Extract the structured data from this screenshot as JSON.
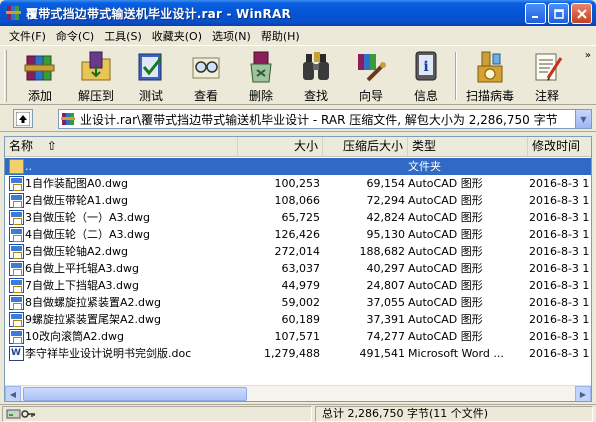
{
  "window": {
    "title": "覆带式挡边带式输送机毕业设计.rar - WinRAR"
  },
  "menu": [
    "文件(F)",
    "命令(C)",
    "工具(S)",
    "收藏夹(O)",
    "选项(N)",
    "帮助(H)"
  ],
  "toolbar": [
    {
      "label": "添加",
      "icon": "rar-books-icon"
    },
    {
      "label": "解压到",
      "icon": "extract-folder-icon"
    },
    {
      "label": "测试",
      "icon": "test-checkmark-icon"
    },
    {
      "label": "查看",
      "icon": "view-glasses-icon"
    },
    {
      "label": "删除",
      "icon": "delete-recycle-icon"
    },
    {
      "label": "查找",
      "icon": "find-binoculars-icon"
    },
    {
      "label": "向导",
      "icon": "wizard-icon"
    },
    {
      "label": "信息",
      "icon": "info-icon"
    },
    {
      "label": "扫描病毒",
      "icon": "virus-scan-icon"
    },
    {
      "label": "注释",
      "icon": "comment-icon"
    }
  ],
  "address": {
    "text": "业设计.rar\\覆带式挡边带式输送机毕业设计 - RAR 压缩文件, 解包大小为 2,286,750 字节"
  },
  "columns": [
    "名称",
    "大小",
    "压缩后大小",
    "类型",
    "修改时间"
  ],
  "files": [
    {
      "name": "..",
      "size": "",
      "packed": "",
      "type": "文件夹",
      "modified": "",
      "icon": "folder-icon",
      "selected": true
    },
    {
      "name": "1自作装配图A0.dwg",
      "size": "100,253",
      "packed": "69,154",
      "type": "AutoCAD 图形",
      "modified": "2016-8-3 1",
      "icon": "dwg-file-icon"
    },
    {
      "name": "2自做压带轮A1.dwg",
      "size": "108,066",
      "packed": "72,294",
      "type": "AutoCAD 图形",
      "modified": "2016-8-3 1",
      "icon": "dwg-file-icon"
    },
    {
      "name": "3自做压轮（一）A3.dwg",
      "size": "65,725",
      "packed": "42,824",
      "type": "AutoCAD 图形",
      "modified": "2016-8-3 1",
      "icon": "dwg-file-icon"
    },
    {
      "name": "4自做压轮（二）A3.dwg",
      "size": "126,426",
      "packed": "95,130",
      "type": "AutoCAD 图形",
      "modified": "2016-8-3 1",
      "icon": "dwg-file-icon"
    },
    {
      "name": "5自做压轮轴A2.dwg",
      "size": "272,014",
      "packed": "188,682",
      "type": "AutoCAD 图形",
      "modified": "2016-8-3 1",
      "icon": "dwg-file-icon"
    },
    {
      "name": "6自做上平托辊A3.dwg",
      "size": "63,037",
      "packed": "40,297",
      "type": "AutoCAD 图形",
      "modified": "2016-8-3 1",
      "icon": "dwg-file-icon"
    },
    {
      "name": "7自做上下挡辊A3.dwg",
      "size": "44,979",
      "packed": "24,807",
      "type": "AutoCAD 图形",
      "modified": "2016-8-3 1",
      "icon": "dwg-file-icon"
    },
    {
      "name": "8自做螺旋拉紧装置A2.dwg",
      "size": "59,002",
      "packed": "37,055",
      "type": "AutoCAD 图形",
      "modified": "2016-8-3 1",
      "icon": "dwg-file-icon"
    },
    {
      "name": "9螺旋拉紧装置尾架A2.dwg",
      "size": "60,189",
      "packed": "37,391",
      "type": "AutoCAD 图形",
      "modified": "2016-8-3 1",
      "icon": "dwg-file-icon"
    },
    {
      "name": "10改向滚筒A2.dwg",
      "size": "107,571",
      "packed": "74,277",
      "type": "AutoCAD 图形",
      "modified": "2016-8-3 1",
      "icon": "dwg-file-icon"
    },
    {
      "name": "李守祥毕业设计说明书完剑版.doc",
      "size": "1,279,488",
      "packed": "491,541",
      "type": "Microsoft Word ...",
      "modified": "2016-8-3 1",
      "icon": "word-doc-icon"
    }
  ],
  "status": {
    "total": "总计 2,286,750 字节(11 个文件)"
  },
  "colors": {
    "title": "#0554d6",
    "selection": "#316ac5",
    "chrome": "#ece9d8"
  }
}
